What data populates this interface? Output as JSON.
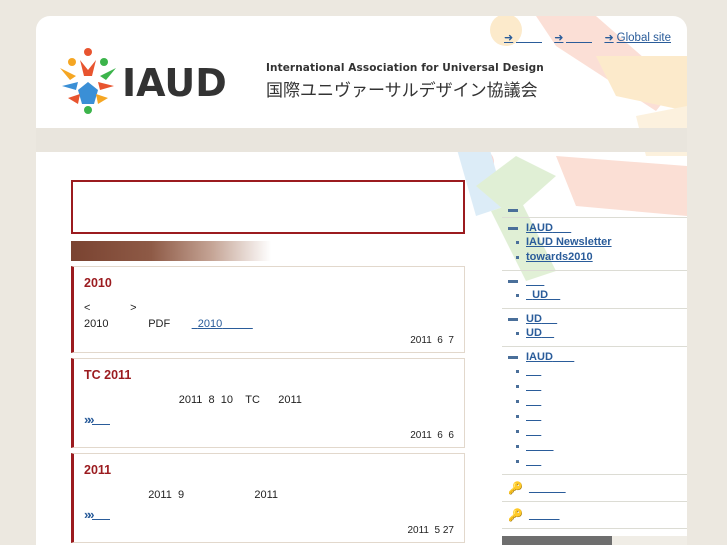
{
  "colors": {
    "accent_red": "#9b1b1f",
    "link_blue": "#2a5c9a",
    "nav_bg": "#e9e5dd",
    "page_bg": "#ece8e0"
  },
  "header": {
    "logo_wordmark": "IAUD",
    "org_name_en": "International Association for Universal Design",
    "org_name_ja": "国際ユニヴァーサルデザイン協議会",
    "top_links": [
      {
        "label": "",
        "icon": "arrow-right-icon"
      },
      {
        "label": "",
        "icon": "arrow-right-icon"
      },
      {
        "label": "Global site",
        "icon": "arrow-right-icon"
      }
    ]
  },
  "news": [
    {
      "title": "2010",
      "lines": [
        {
          "a": "<",
          "b": ">"
        },
        {
          "a": "2010",
          "b": "PDF",
          "link": "2010"
        }
      ],
      "date": "2011  6  7"
    },
    {
      "title_a": "TC",
      "title_b": "2011",
      "line_a": "2011  8  10",
      "line_b": "TC",
      "line_c": "2011",
      "more_icon": "double-chevron-icon",
      "date": "2011  6  6"
    },
    {
      "title": "2011",
      "line_a": "2011  9",
      "line_b": "2011",
      "more_icon": "double-chevron-icon",
      "date": "2011  5 27"
    }
  ],
  "sidebar": {
    "sections": [
      {
        "head": "",
        "items": []
      },
      {
        "head": "IAUD",
        "items": [
          "IAUD Newsletter",
          "towards2010"
        ]
      },
      {
        "head": "",
        "items": [
          "UD"
        ]
      },
      {
        "head": "UD",
        "items": [
          "UD"
        ]
      },
      {
        "head": "IAUD",
        "items": [
          "",
          "",
          "",
          "",
          "",
          "",
          ""
        ]
      }
    ],
    "key_links": [
      "",
      ""
    ],
    "key_icon": "key-icon"
  }
}
